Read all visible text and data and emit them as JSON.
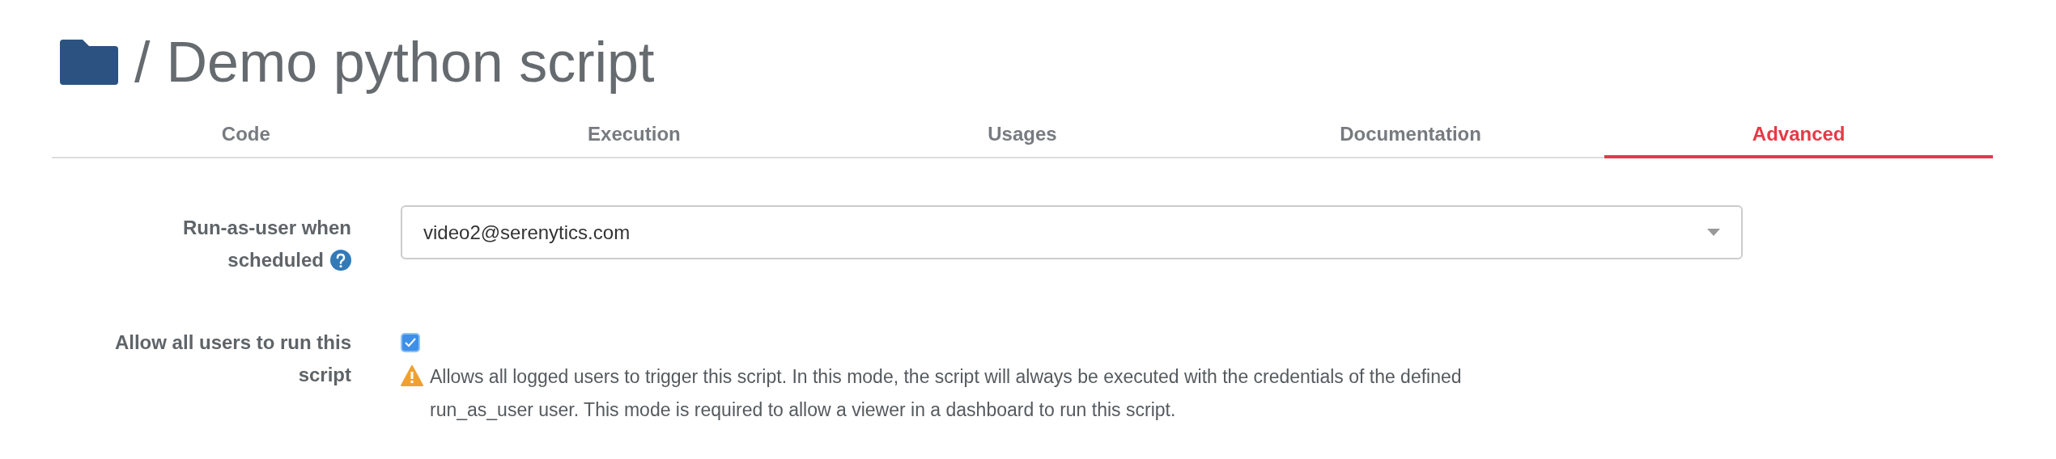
{
  "header": {
    "separator": "/",
    "title": "Demo python script"
  },
  "tabs": [
    {
      "label": "Code",
      "selected": false
    },
    {
      "label": "Execution",
      "selected": false
    },
    {
      "label": "Usages",
      "selected": false
    },
    {
      "label": "Documentation",
      "selected": false
    },
    {
      "label": "Advanced",
      "selected": true
    }
  ],
  "form": {
    "run_as_user": {
      "label_lines": [
        "Run-as-user when",
        "scheduled"
      ],
      "value": "video2@serenytics.com"
    },
    "allow_all": {
      "label_lines": [
        "Allow all users to run this",
        "script"
      ],
      "checked": true,
      "warning": "Allows all logged users to trigger this script. In this mode, the script will always be executed with the credentials of the defined run_as_user user. This mode is required to allow a viewer in a dashboard to run this script."
    }
  }
}
